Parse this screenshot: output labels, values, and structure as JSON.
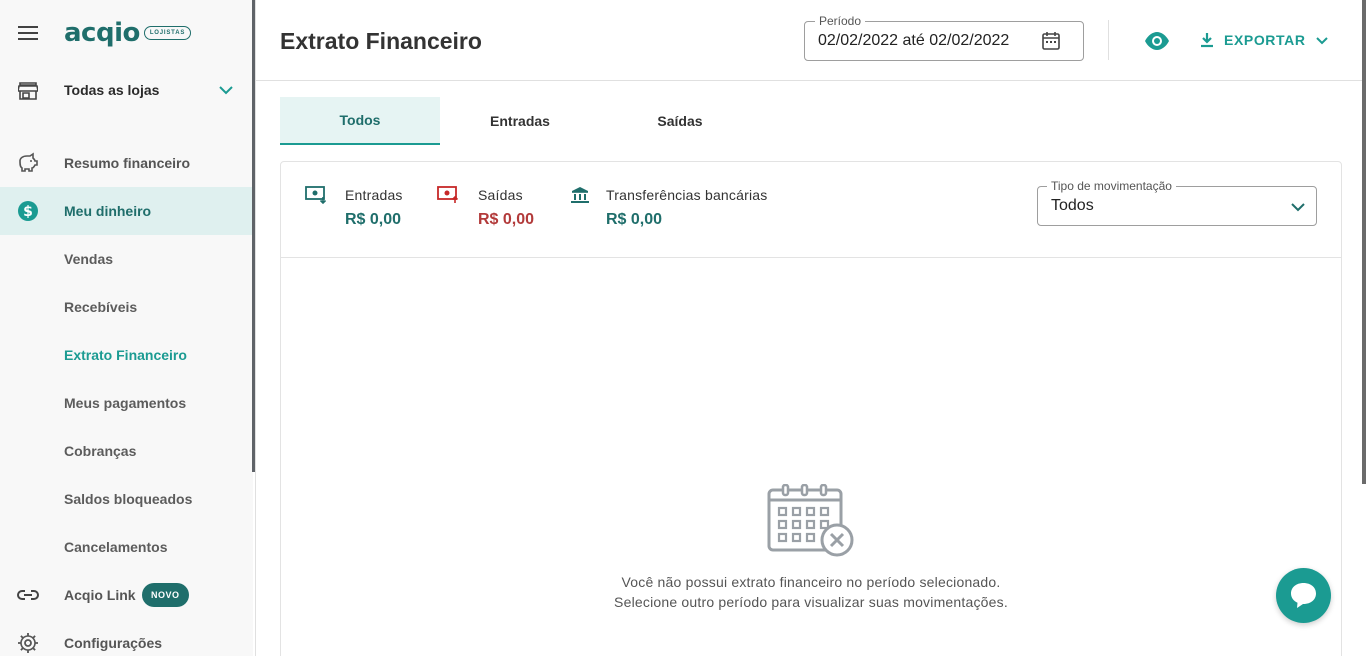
{
  "brand": {
    "logo_text": "acqio",
    "logo_badge": "LOJISTAS",
    "primary": "#1f6e6b",
    "accent": "#1b9b92",
    "negative": "#b23a3a"
  },
  "sidebar": {
    "store_selector": {
      "label": "Todas as lojas",
      "icon": "store-icon"
    },
    "items": [
      {
        "label": "Resumo financeiro",
        "icon": "piggy-bank-icon"
      },
      {
        "label": "Meu dinheiro",
        "icon": "dollar-circle-icon",
        "active": true
      },
      {
        "label": "Vendas"
      },
      {
        "label": "Recebíveis"
      },
      {
        "label": "Extrato Financeiro",
        "current": true
      },
      {
        "label": "Meus pagamentos"
      },
      {
        "label": "Cobranças"
      },
      {
        "label": "Saldos bloqueados"
      },
      {
        "label": "Cancelamentos"
      },
      {
        "label": "Acqio Link",
        "icon": "link-icon",
        "badge": "NOVO"
      },
      {
        "label": "Configurações",
        "icon": "gear-icon"
      }
    ]
  },
  "header": {
    "title": "Extrato Financeiro",
    "period_label": "Período",
    "period_value": "02/02/2022 até 02/02/2022",
    "export_label": "EXPORTAR"
  },
  "tabs": [
    {
      "label": "Todos",
      "active": true
    },
    {
      "label": "Entradas"
    },
    {
      "label": "Saídas"
    }
  ],
  "summary": {
    "entradas": {
      "label": "Entradas",
      "value": "R$ 0,00"
    },
    "saidas": {
      "label": "Saídas",
      "value": "R$ 0,00"
    },
    "transferencias": {
      "label": "Transferências bancárias",
      "value": "R$ 0,00"
    }
  },
  "filter": {
    "label": "Tipo de movimentação",
    "value": "Todos"
  },
  "empty_state": {
    "line1": "Você não possui extrato financeiro no período selecionado.",
    "line2": "Selecione outro período para visualizar suas movimentações."
  }
}
